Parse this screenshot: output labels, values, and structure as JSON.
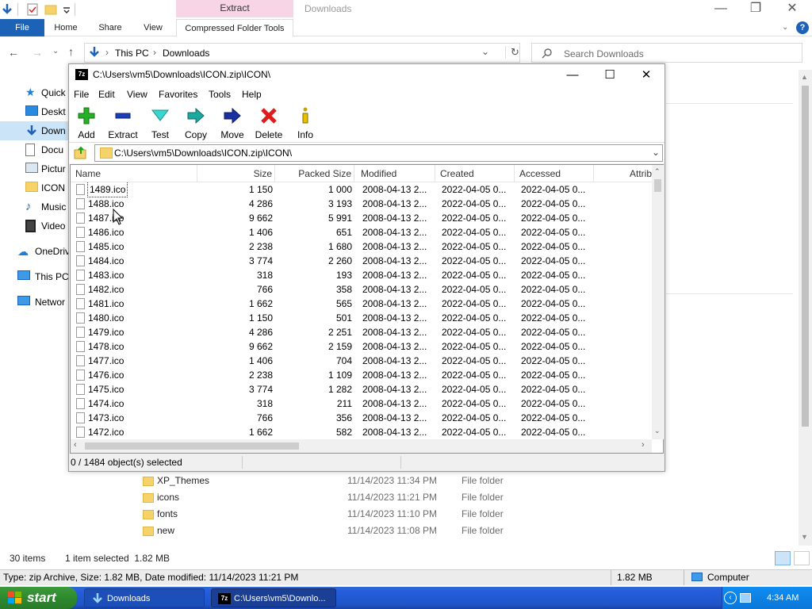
{
  "explorer": {
    "window_title": "Downloads",
    "context_tab": "Extract",
    "ribbon_tabs": [
      "File",
      "Home",
      "Share",
      "View",
      "Compressed Folder Tools"
    ],
    "breadcrumb": [
      "This PC",
      "Downloads"
    ],
    "search_placeholder": "Search Downloads",
    "nav_items": [
      "Quick a",
      "Deskt",
      "Down",
      "Docu",
      "Pictur",
      "ICON",
      "Music",
      "Video",
      "OneDriv",
      "This PC",
      "Networ"
    ],
    "files": [
      {
        "name": "XP_Themes",
        "date": "11/14/2023 11:34 PM",
        "type": "File folder"
      },
      {
        "name": "icons",
        "date": "11/14/2023 11:21 PM",
        "type": "File folder"
      },
      {
        "name": "fonts",
        "date": "11/14/2023 11:10 PM",
        "type": "File folder"
      },
      {
        "name": "new",
        "date": "11/14/2023 11:08 PM",
        "type": "File folder"
      }
    ],
    "status_items": "30 items",
    "status_selected": "1 item selected  1.82 MB",
    "info_text": "Type: zip Archive, Size: 1.82 MB, Date modified: 11/14/2023 11:21 PM",
    "info_size": "1.82 MB",
    "info_location": "Computer"
  },
  "sevenzip": {
    "title": "C:\\Users\\vm5\\Downloads\\ICON.zip\\ICON\\",
    "menu": [
      "File",
      "Edit",
      "View",
      "Favorites",
      "Tools",
      "Help"
    ],
    "toolbar": [
      "Add",
      "Extract",
      "Test",
      "Copy",
      "Move",
      "Delete",
      "Info"
    ],
    "path": "C:\\Users\\vm5\\Downloads\\ICON.zip\\ICON\\",
    "columns": [
      "Name",
      "Size",
      "Packed Size",
      "Modified",
      "Created",
      "Accessed",
      "Attrib"
    ],
    "rows": [
      {
        "name": "1489.ico",
        "size": "1 150",
        "packed": "1 000",
        "modified": "2008-04-13 2...",
        "created": "2022-04-05 0...",
        "accessed": "2022-04-05 0..."
      },
      {
        "name": "1488.ico",
        "size": "4 286",
        "packed": "3 193",
        "modified": "2008-04-13 2...",
        "created": "2022-04-05 0...",
        "accessed": "2022-04-05 0..."
      },
      {
        "name": "1487.ico",
        "size": "9 662",
        "packed": "5 991",
        "modified": "2008-04-13 2...",
        "created": "2022-04-05 0...",
        "accessed": "2022-04-05 0..."
      },
      {
        "name": "1486.ico",
        "size": "1 406",
        "packed": "651",
        "modified": "2008-04-13 2...",
        "created": "2022-04-05 0...",
        "accessed": "2022-04-05 0..."
      },
      {
        "name": "1485.ico",
        "size": "2 238",
        "packed": "1 680",
        "modified": "2008-04-13 2...",
        "created": "2022-04-05 0...",
        "accessed": "2022-04-05 0..."
      },
      {
        "name": "1484.ico",
        "size": "3 774",
        "packed": "2 260",
        "modified": "2008-04-13 2...",
        "created": "2022-04-05 0...",
        "accessed": "2022-04-05 0..."
      },
      {
        "name": "1483.ico",
        "size": "318",
        "packed": "193",
        "modified": "2008-04-13 2...",
        "created": "2022-04-05 0...",
        "accessed": "2022-04-05 0..."
      },
      {
        "name": "1482.ico",
        "size": "766",
        "packed": "358",
        "modified": "2008-04-13 2...",
        "created": "2022-04-05 0...",
        "accessed": "2022-04-05 0..."
      },
      {
        "name": "1481.ico",
        "size": "1 662",
        "packed": "565",
        "modified": "2008-04-13 2...",
        "created": "2022-04-05 0...",
        "accessed": "2022-04-05 0..."
      },
      {
        "name": "1480.ico",
        "size": "1 150",
        "packed": "501",
        "modified": "2008-04-13 2...",
        "created": "2022-04-05 0...",
        "accessed": "2022-04-05 0..."
      },
      {
        "name": "1479.ico",
        "size": "4 286",
        "packed": "2 251",
        "modified": "2008-04-13 2...",
        "created": "2022-04-05 0...",
        "accessed": "2022-04-05 0..."
      },
      {
        "name": "1478.ico",
        "size": "9 662",
        "packed": "2 159",
        "modified": "2008-04-13 2...",
        "created": "2022-04-05 0...",
        "accessed": "2022-04-05 0..."
      },
      {
        "name": "1477.ico",
        "size": "1 406",
        "packed": "704",
        "modified": "2008-04-13 2...",
        "created": "2022-04-05 0...",
        "accessed": "2022-04-05 0..."
      },
      {
        "name": "1476.ico",
        "size": "2 238",
        "packed": "1 109",
        "modified": "2008-04-13 2...",
        "created": "2022-04-05 0...",
        "accessed": "2022-04-05 0..."
      },
      {
        "name": "1475.ico",
        "size": "3 774",
        "packed": "1 282",
        "modified": "2008-04-13 2...",
        "created": "2022-04-05 0...",
        "accessed": "2022-04-05 0..."
      },
      {
        "name": "1474.ico",
        "size": "318",
        "packed": "211",
        "modified": "2008-04-13 2...",
        "created": "2022-04-05 0...",
        "accessed": "2022-04-05 0..."
      },
      {
        "name": "1473.ico",
        "size": "766",
        "packed": "356",
        "modified": "2008-04-13 2...",
        "created": "2022-04-05 0...",
        "accessed": "2022-04-05 0..."
      },
      {
        "name": "1472.ico",
        "size": "1 662",
        "packed": "582",
        "modified": "2008-04-13 2...",
        "created": "2022-04-05 0...",
        "accessed": "2022-04-05 0..."
      }
    ],
    "status": "0 / 1484 object(s) selected"
  },
  "taskbar": {
    "start_label": "start",
    "items": [
      "Downloads",
      "C:\\Users\\vm5\\Downlo..."
    ],
    "clock": "4:34 AM"
  },
  "colors": {
    "accent": "#1c63b7",
    "taskbar": "#245edb",
    "start": "#2d8a2d"
  }
}
